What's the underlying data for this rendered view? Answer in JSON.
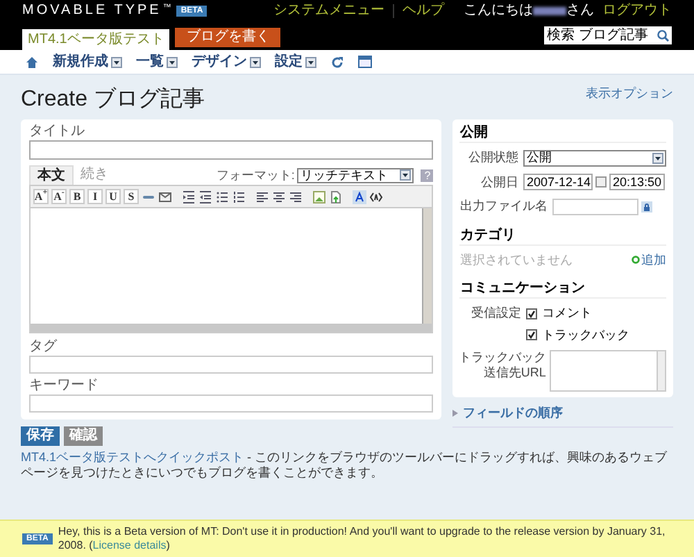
{
  "header": {
    "logo": "MOVABLE TYPE",
    "logo_tm": "™",
    "logo_badge": "BETA",
    "system_menu": "システムメニュー",
    "help": "ヘルプ",
    "greeting_before": "こんにちは",
    "greeting_after": "さん",
    "logout": "ログアウト",
    "blog_tab": "MT4.1ベータ版テスト",
    "write_button": "ブログを書く",
    "search_placeholder": "検索 ブログ記事"
  },
  "nav": [
    {
      "kind": "home"
    },
    {
      "kind": "menu",
      "label": "新規作成"
    },
    {
      "kind": "menu",
      "label": "一覧"
    },
    {
      "kind": "menu",
      "label": "デザイン"
    },
    {
      "kind": "menu",
      "label": "設定"
    },
    {
      "kind": "refresh"
    },
    {
      "kind": "window"
    }
  ],
  "page": {
    "title": "Create ブログ記事",
    "display_options": "表示オプション"
  },
  "entry": {
    "title_label": "タイトル",
    "tabs": [
      {
        "label": "本文",
        "selected": true
      },
      {
        "label": "続き",
        "selected": false
      }
    ],
    "format_label": "フォーマット:",
    "format_value": "リッチテキスト",
    "help": "?",
    "toolbar": [
      {
        "kind": "text",
        "label": "A$^{+}$"
      },
      {
        "kind": "text",
        "label": "A$^{-}$"
      },
      {
        "kind": "text",
        "label": "B"
      },
      {
        "kind": "text",
        "label": "I"
      },
      {
        "kind": "text",
        "label": "U"
      },
      {
        "kind": "text",
        "label": "S"
      },
      {
        "kind": "icon"
      },
      {
        "kind": "icon"
      },
      {
        "kind": "gap"
      },
      {
        "kind": "icon"
      },
      {
        "kind": "icon"
      },
      {
        "kind": "icon"
      },
      {
        "kind": "icon"
      },
      {
        "kind": "gap"
      },
      {
        "kind": "icon"
      },
      {
        "kind": "icon"
      },
      {
        "kind": "icon"
      },
      {
        "kind": "gap"
      },
      {
        "kind": "icon"
      },
      {
        "kind": "icon"
      },
      {
        "kind": "gap"
      },
      {
        "kind": "icon"
      },
      {
        "kind": "icon"
      }
    ],
    "tags_label": "タグ",
    "keywords_label": "キーワード"
  },
  "buttons": [
    {
      "label": "保存",
      "kind": "primary"
    },
    {
      "label": "確認",
      "kind": "secondary"
    }
  ],
  "quickpost": {
    "link": "MT4.1ベータ版テストへクイックポスト",
    "text": " - このリンクをブラウザのツールバーにドラッグすれば、興味のあるウェブページを見つけたときにいつでもブログを書くことができます。"
  },
  "publish": {
    "heading": "公開",
    "status_label": "公開状態",
    "status_value": "公開",
    "date_label": "公開日",
    "date": "2007-12-14",
    "time": "20:13:50",
    "filename_label": "出力ファイル名"
  },
  "category": {
    "heading": "カテゴリ",
    "empty": "選択されていません",
    "add": "追加"
  },
  "communication": {
    "heading": "コミュニケーション",
    "accept_label": "受信設定",
    "options": [
      {
        "label": "コメント",
        "checked": true
      },
      {
        "label": "トラックバック",
        "checked": true
      }
    ],
    "trackback_label": [
      "トラックバック",
      "送信先URL"
    ]
  },
  "field_order": "フィールドの順序",
  "footer": {
    "badge": "BETA",
    "message": "Hey, this is a Beta version of MT: Don't use it in production! And you'll want to upgrade to the release version by January 31, 2008. (",
    "link": "License details",
    "link_close": ")"
  }
}
